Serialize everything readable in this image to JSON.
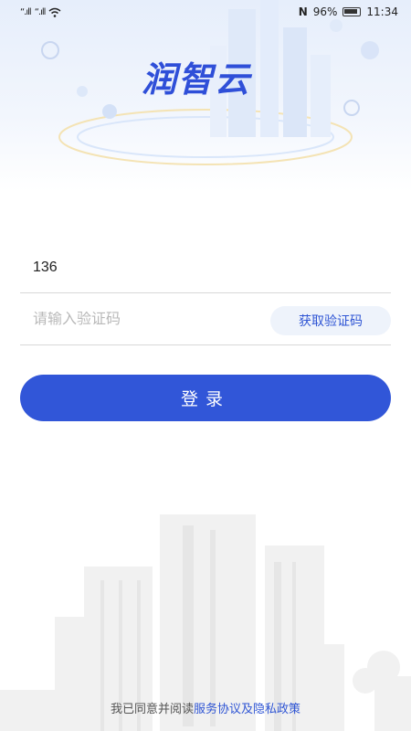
{
  "status_bar": {
    "signal_1": "“.ıll",
    "signal_2": "“.ıll",
    "nfc": "N",
    "battery_percent": "96%",
    "time": "11:34"
  },
  "app": {
    "logo_text": "润智云"
  },
  "form": {
    "phone_value": "136",
    "code_placeholder": "请输入验证码",
    "get_code_label": "获取验证码",
    "login_label": "登录"
  },
  "agreement": {
    "prefix": "我已同意并阅读",
    "link": "服务协议及隐私政策"
  },
  "colors": {
    "primary": "#3156d8",
    "link": "#2f55d4",
    "code_button_bg": "#eef3fb"
  }
}
